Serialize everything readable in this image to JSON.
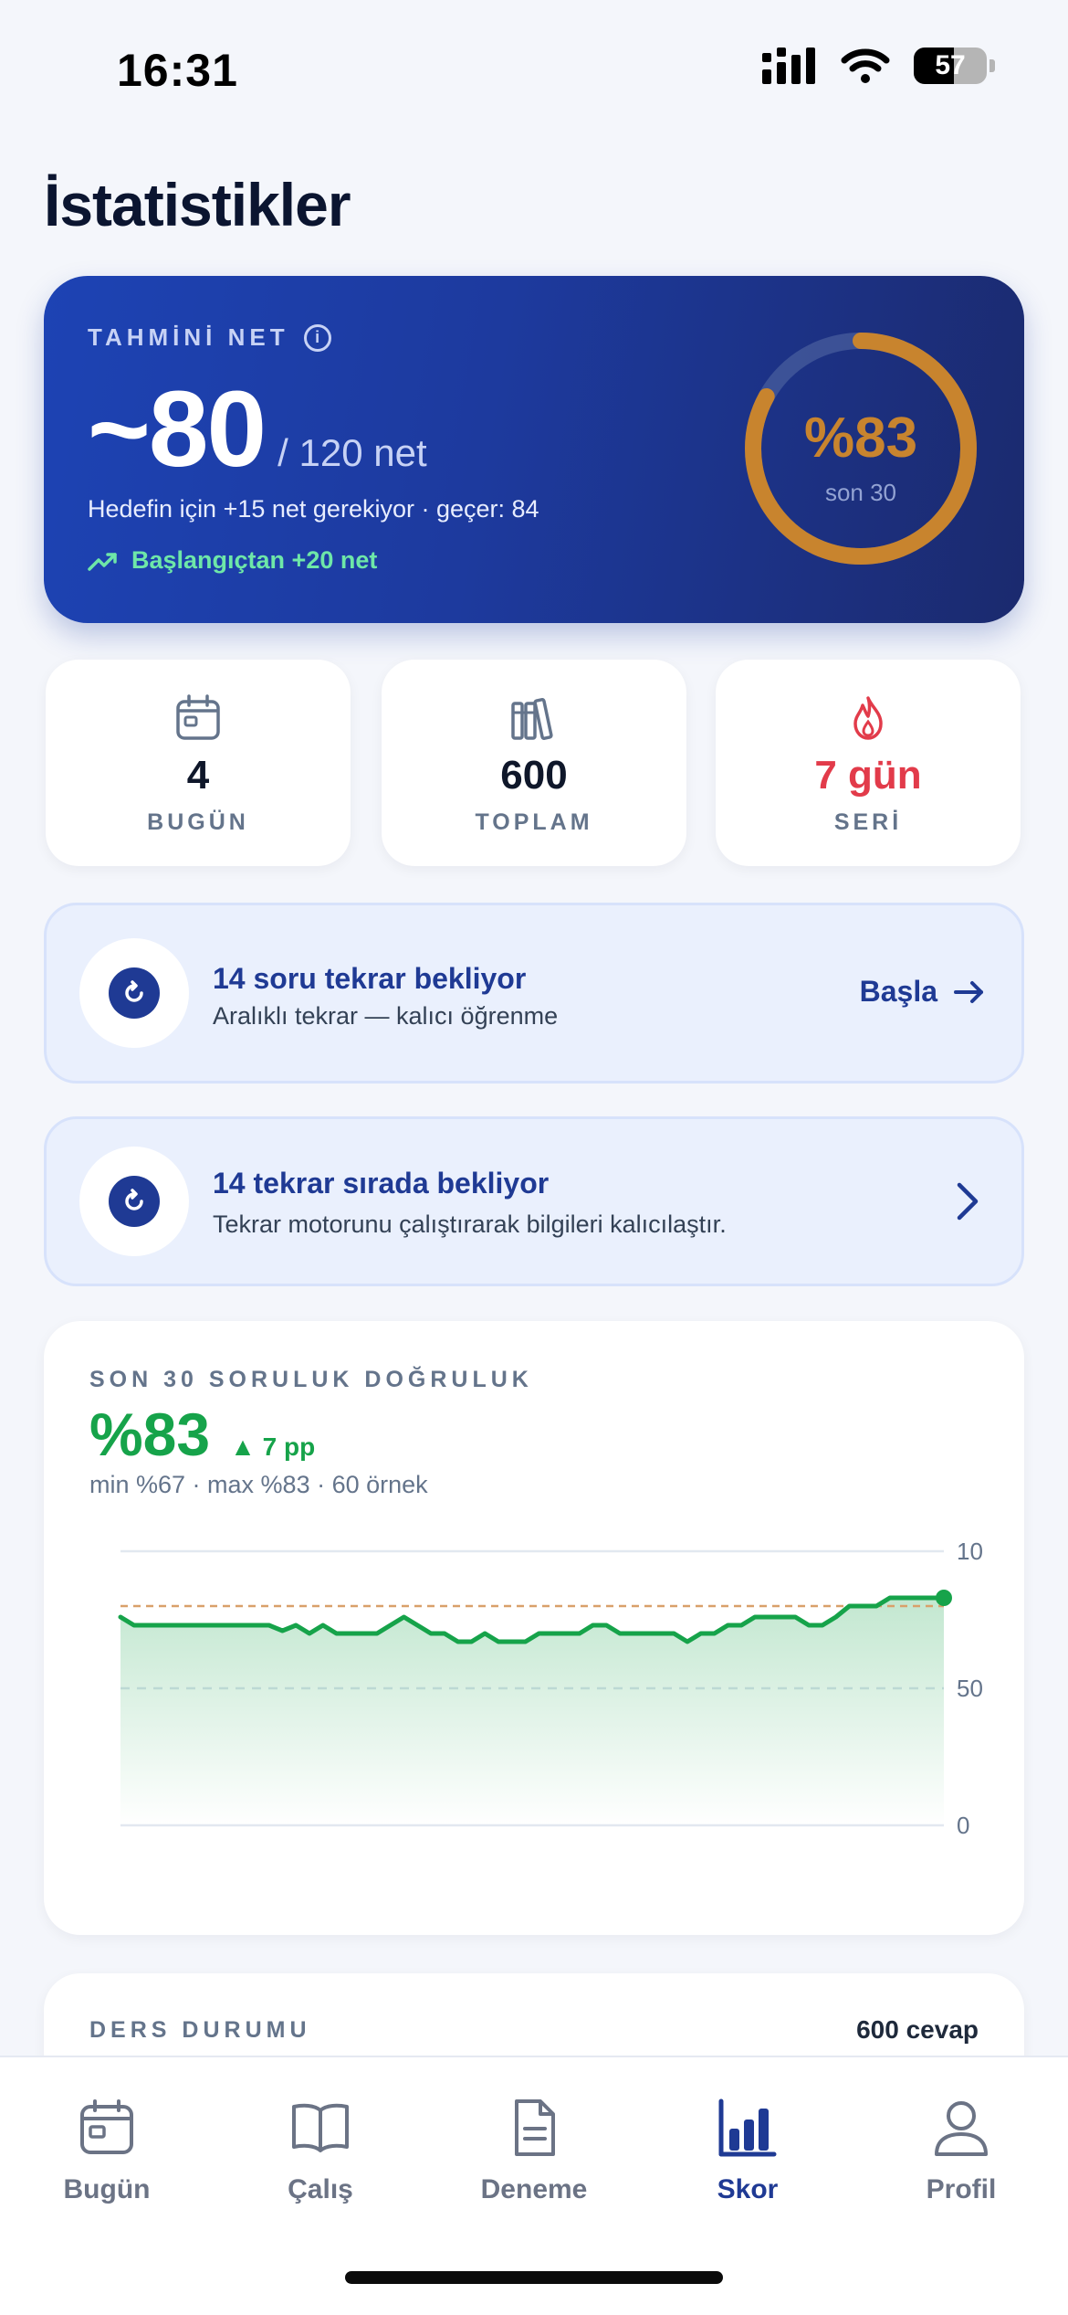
{
  "status": {
    "time": "16:31",
    "battery": "57"
  },
  "page_title": "İstatistikler",
  "hero": {
    "label": "TAHMİNİ NET",
    "value": "~80",
    "value_sub": "/ 120 net",
    "need_text": "Hedefin için +15 net gerekiyor · geçer: 84",
    "trend_text": "Başlangıçtan +20 net",
    "ring_pct": "%83",
    "ring_progress": 0.83,
    "ring_sub": "son 30",
    "ring_color": "#c8842e"
  },
  "stats": [
    {
      "value": "4",
      "label": "BUGÜN",
      "icon": "calendar-icon"
    },
    {
      "value": "600",
      "label": "TOPLAM",
      "icon": "library-icon"
    },
    {
      "value": "7 gün",
      "label": "SERİ",
      "icon": "flame-icon",
      "color": "#e23b4a"
    }
  ],
  "review_due": {
    "title": "14 soru tekrar bekliyor",
    "subtitle": "Aralıklı tekrar — kalıcı öğrenme",
    "action": "Başla"
  },
  "review_queue": {
    "title": "14 tekrar sırada bekliyor",
    "subtitle": "Tekrar motorunu çalıştırarak bilgileri kalıcılaştır."
  },
  "accuracy": {
    "label": "SON 30 SORULUK DOĞRULUK",
    "value": "%83",
    "delta": "7 pp",
    "minmax": "min %67 · max %83 · 60 örnek"
  },
  "chart_data": {
    "type": "area",
    "title": "",
    "xlabel": "",
    "ylabel": "",
    "ylim": [
      0,
      100
    ],
    "y_ticks": [
      "0",
      "50",
      "10"
    ],
    "target_line": 80,
    "series": [
      {
        "values": [
          76,
          73,
          73,
          73,
          73,
          73,
          73,
          73,
          73,
          73,
          73,
          73,
          71,
          73,
          70,
          73,
          70,
          70,
          70,
          70,
          73,
          76,
          73,
          70,
          70,
          67,
          67,
          70,
          67,
          67,
          67,
          70,
          70,
          70,
          70,
          73,
          73,
          70,
          70,
          70,
          70,
          70,
          67,
          70,
          70,
          73,
          73,
          76,
          76,
          76,
          76,
          73,
          73,
          76,
          80,
          80,
          80,
          83,
          83,
          83,
          83,
          83
        ]
      }
    ],
    "line_color": "#16a34a",
    "target_color": "#d9a06a"
  },
  "ders": {
    "label": "DERS DURUMU",
    "right": "600 cevap"
  },
  "tabs": [
    {
      "label": "Bugün",
      "icon": "calendar-icon"
    },
    {
      "label": "Çalış",
      "icon": "book-icon"
    },
    {
      "label": "Deneme",
      "icon": "document-icon"
    },
    {
      "label": "Skor",
      "icon": "bar-chart-icon",
      "active": true
    },
    {
      "label": "Profil",
      "icon": "person-icon"
    }
  ]
}
